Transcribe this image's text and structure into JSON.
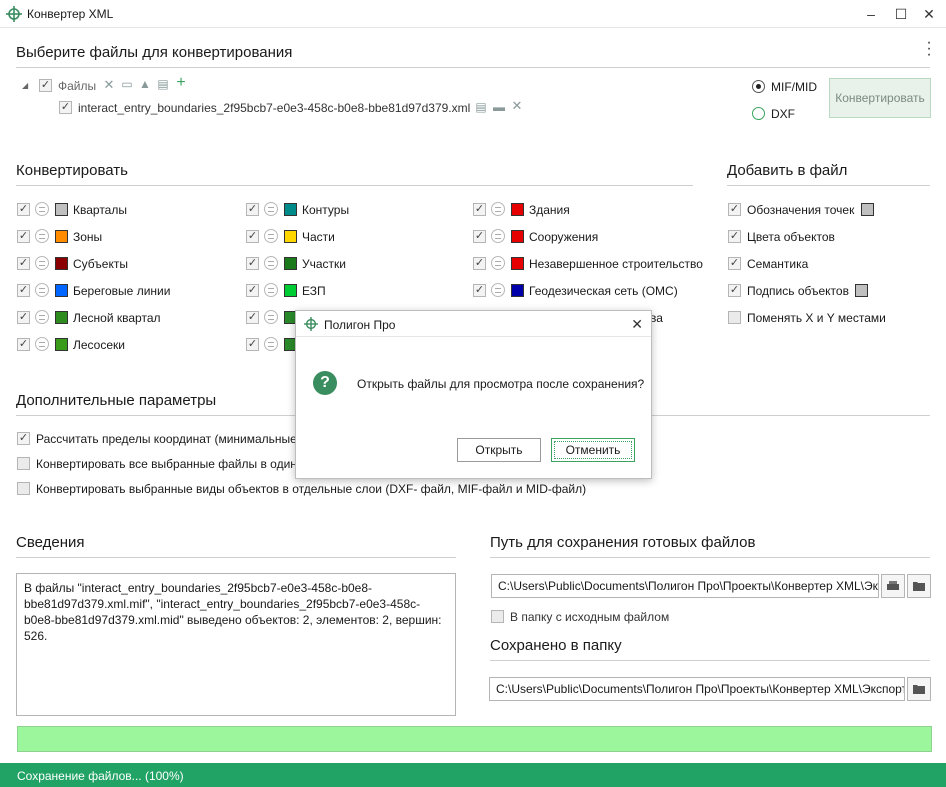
{
  "window": {
    "title": "Конвертер XML"
  },
  "sections": {
    "files": "Выберите файлы для конвертирования",
    "convert": "Конвертировать",
    "add_to_file": "Добавить в файл",
    "extra_params": "Дополнительные параметры",
    "info": "Сведения",
    "save_path": "Путь для сохранения готовых файлов",
    "saved_to": "Сохранено в папку"
  },
  "file_tree": {
    "root_label": "Файлы",
    "file_name": "interact_entry_boundaries_2f95bcb7-e0e3-458c-b0e8-bbe81d97d379.xml"
  },
  "format": {
    "options": [
      "MIF/MID",
      "DXF"
    ],
    "selected": "MIF/MID"
  },
  "convert_button": "Конвертировать",
  "layers": {
    "col1": [
      {
        "label": "Кварталы",
        "color": "#c0c0c0"
      },
      {
        "label": "Зоны",
        "color": "#ff8c00"
      },
      {
        "label": "Субъекты",
        "color": "#8b0000"
      },
      {
        "label": "Береговые линии",
        "color": "#0066ff"
      },
      {
        "label": "Лесной квартал",
        "color": "#2e8b1e"
      },
      {
        "label": "Лесосеки",
        "color": "#3a9a1a"
      }
    ],
    "col2": [
      {
        "label": "Контуры",
        "color": "#008b8b"
      },
      {
        "label": "Части",
        "color": "#ffd700"
      },
      {
        "label": "Участки",
        "color": "#1a7a1a"
      },
      {
        "label": "ЕЗП",
        "color": "#00cc33"
      },
      {
        "label": "",
        "color": "#2a8a2a"
      },
      {
        "label": "",
        "color": "#2a8a2a"
      }
    ],
    "col3": [
      {
        "label": "Здания",
        "color": "#e60000"
      },
      {
        "label": "Сооружения",
        "color": "#e60000"
      },
      {
        "label": "Незавершенное строительство",
        "color": "#e60000"
      },
      {
        "label": "Геодезическая сеть (ОМС)",
        "color": "#0000aa"
      },
      {
        "label": "ва",
        "color": ""
      }
    ]
  },
  "add_options": [
    {
      "label": "Обозначения точек",
      "checked": true,
      "swatch": "#c0c0c0"
    },
    {
      "label": "Цвета объектов",
      "checked": true,
      "swatch": ""
    },
    {
      "label": "Семантика",
      "checked": true,
      "swatch": ""
    },
    {
      "label": "Подпись объектов",
      "checked": true,
      "swatch": "#c0c0c0"
    },
    {
      "label": "Поменять X и Y местами",
      "checked": false,
      "swatch": ""
    }
  ],
  "extra_params": [
    {
      "label": "Рассчитать пределы координат (минимальные",
      "checked": true
    },
    {
      "label": "Конвертировать все выбранные файлы в один",
      "checked": false
    },
    {
      "label": "Конвертировать выбранные виды объектов в отдельные слои (DXF- файл, MIF-файл и MID-файл)",
      "checked": false
    }
  ],
  "info_text": "В файлы \"interact_entry_boundaries_2f95bcb7-e0e3-458c-b0e8-bbe81d97d379.xml.mif\", \"interact_entry_boundaries_2f95bcb7-e0e3-458c-b0e8-bbe81d97d379.xml.mid\" выведено объектов: 2, элементов: 2, вершин: 526.",
  "save_path": {
    "value": "C:\\Users\\Public\\Documents\\Полигон Про\\Проекты\\Конвертер XML\\Экспорт",
    "same_folder_label": "В папку с исходным файлом"
  },
  "saved_to": {
    "value": "C:\\Users\\Public\\Documents\\Полигон Про\\Проекты\\Конвертер XML\\Экспорт"
  },
  "progress": {
    "percent": 100
  },
  "status": "Сохранение файлов... (100%)",
  "dialog": {
    "title": "Полигон Про",
    "message": "Открыть файлы для просмотра после сохранения?",
    "ok_label": "Открыть",
    "cancel_label": "Отменить"
  },
  "colors": {
    "accent": "#21a366",
    "progress_fill": "#9cf79c"
  }
}
